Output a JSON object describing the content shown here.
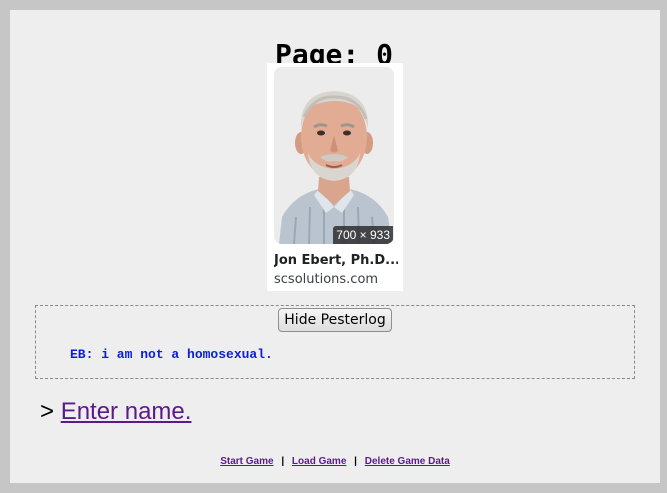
{
  "header": {
    "page_label": "Page: 0"
  },
  "image_card": {
    "dimensions": "700 × 933",
    "title": "Jon Ebert, Ph.D....",
    "source": "scsolutions.com"
  },
  "pesterlog": {
    "toggle_label": "Hide Pesterlog",
    "lines": [
      "EB: i am not a homosexual."
    ]
  },
  "command": {
    "prompt": "> ",
    "link_label": "Enter name."
  },
  "footer": {
    "start_label": "Start Game",
    "load_label": "Load Game",
    "delete_label": "Delete Game Data",
    "separator": "|"
  },
  "colors": {
    "link": "#5b1a8c",
    "pester_text": "#0a1fd6",
    "page_bg": "#eeeeee",
    "outer_bg": "#c6c6c6"
  }
}
